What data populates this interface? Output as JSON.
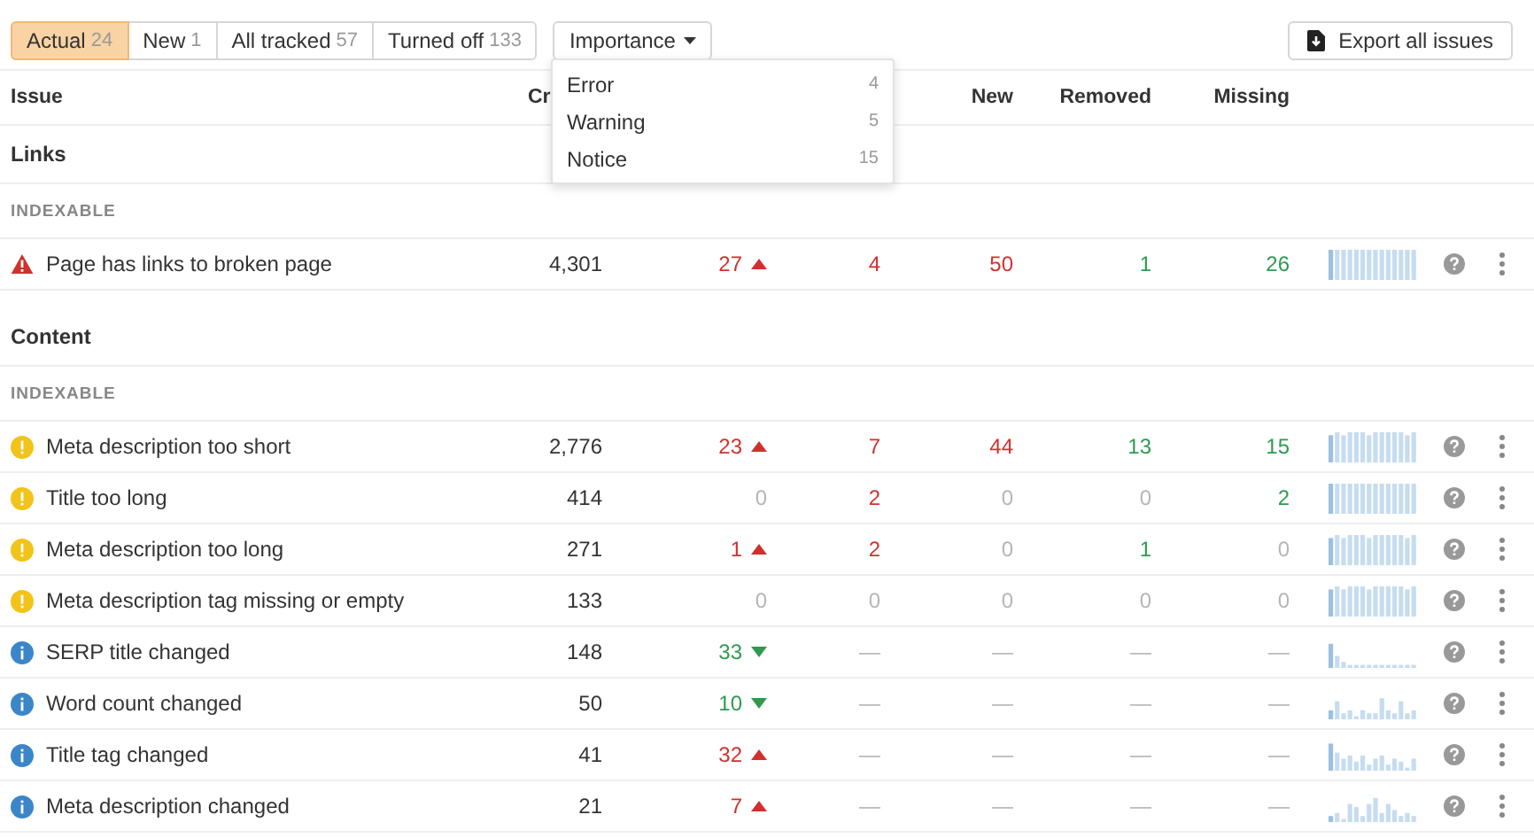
{
  "tabs": [
    {
      "label": "Actual",
      "count": "24",
      "selected": true
    },
    {
      "label": "New",
      "count": "1",
      "selected": false
    },
    {
      "label": "All tracked",
      "count": "57",
      "selected": false
    },
    {
      "label": "Turned off",
      "count": "133",
      "selected": false
    }
  ],
  "importance": {
    "label": "Importance",
    "expanded": true,
    "options": [
      {
        "label": "Error",
        "count": "4"
      },
      {
        "label": "Warning",
        "count": "5"
      },
      {
        "label": "Notice",
        "count": "15"
      }
    ]
  },
  "export_button": "Export all issues",
  "table": {
    "columns": [
      "Issue",
      "Cr",
      "New",
      "Removed",
      "Missing"
    ],
    "sections": [
      {
        "title": "Links",
        "groups": [
          {
            "label": "INDEXABLE",
            "rows": [
              {
                "kind": "error",
                "issue": "Page has links to broken page",
                "crawled": "4,301",
                "change": {
                  "text": "27",
                  "color": "#d0312d",
                  "kind": "up"
                },
                "column_4": {
                  "text": "4",
                  "color": "#d0312d"
                },
                "new": {
                  "text": "50",
                  "color": "#d0312d"
                },
                "removed": {
                  "text": "1",
                  "color": "#2e9a4e"
                },
                "missing": {
                  "text": "26",
                  "color": "#2e9a4e"
                }
              }
            ]
          }
        ]
      },
      {
        "title": "Content",
        "groups": [
          {
            "label": "INDEXABLE",
            "rows": [
              {
                "kind": "warning",
                "issue": "Meta description too short",
                "crawled": "2,776",
                "change": {
                  "text": "23",
                  "color": "#d0312d",
                  "kind": "up"
                },
                "column_4": {
                  "text": "7",
                  "color": "#d0312d"
                },
                "new": {
                  "text": "44",
                  "color": "#d0312d"
                },
                "removed": {
                  "text": "13",
                  "color": "#2e9a4e"
                },
                "missing": {
                  "text": "15",
                  "color": "#2e9a4e"
                }
              },
              {
                "kind": "warning",
                "issue": "Title too long",
                "crawled": "414",
                "change": {
                  "text": "0",
                  "color": "#b5b5b5",
                  "kind": "none"
                },
                "column_4": {
                  "text": "2",
                  "color": "#d0312d"
                },
                "new": {
                  "text": "0",
                  "color": "#b5b5b5"
                },
                "removed": {
                  "text": "0",
                  "color": "#b5b5b5"
                },
                "missing": {
                  "text": "2",
                  "color": "#2e9a4e"
                }
              },
              {
                "kind": "warning",
                "issue": "Meta description too long",
                "crawled": "271",
                "change": {
                  "text": "1",
                  "color": "#d0312d",
                  "kind": "up"
                },
                "column_4": {
                  "text": "2",
                  "color": "#d0312d"
                },
                "new": {
                  "text": "0",
                  "color": "#b5b5b5"
                },
                "removed": {
                  "text": "1",
                  "color": "#2e9a4e"
                },
                "missing": {
                  "text": "0",
                  "color": "#b5b5b5"
                }
              },
              {
                "kind": "warning",
                "issue": "Meta description tag missing or empty",
                "crawled": "133",
                "change": {
                  "text": "0",
                  "color": "#b5b5b5",
                  "kind": "none"
                },
                "column_4": {
                  "text": "0",
                  "color": "#b5b5b5"
                },
                "new": {
                  "text": "0",
                  "color": "#b5b5b5"
                },
                "removed": {
                  "text": "0",
                  "color": "#b5b5b5"
                },
                "missing": {
                  "text": "0",
                  "color": "#b5b5b5"
                }
              },
              {
                "kind": "notice",
                "issue": "SERP title changed",
                "crawled": "148",
                "change": {
                  "text": "33",
                  "color": "#2e9a4e",
                  "kind": "down"
                },
                "column_4": {
                  "text": "—",
                  "color": "#b5b5b5"
                },
                "new": {
                  "text": "—",
                  "color": "#b5b5b5"
                },
                "removed": {
                  "text": "—",
                  "color": "#b5b5b5"
                },
                "missing": {
                  "text": "—",
                  "color": "#b5b5b5"
                }
              },
              {
                "kind": "notice",
                "issue": "Word count changed",
                "crawled": "50",
                "change": {
                  "text": "10",
                  "color": "#2e9a4e",
                  "kind": "down"
                },
                "column_4": {
                  "text": "—",
                  "color": "#b5b5b5"
                },
                "new": {
                  "text": "—",
                  "color": "#b5b5b5"
                },
                "removed": {
                  "text": "—",
                  "color": "#b5b5b5"
                },
                "missing": {
                  "text": "—",
                  "color": "#b5b5b5"
                }
              },
              {
                "kind": "notice",
                "issue": "Title tag changed",
                "crawled": "41",
                "change": {
                  "text": "32",
                  "color": "#d0312d",
                  "kind": "up"
                },
                "column_4": {
                  "text": "—",
                  "color": "#b5b5b5"
                },
                "new": {
                  "text": "—",
                  "color": "#b5b5b5"
                },
                "removed": {
                  "text": "—",
                  "color": "#b5b5b5"
                },
                "missing": {
                  "text": "—",
                  "color": "#b5b5b5"
                }
              },
              {
                "kind": "notice",
                "issue": "Meta description changed",
                "crawled": "21",
                "change": {
                  "text": "7",
                  "color": "#d0312d",
                  "kind": "up"
                },
                "column_4": {
                  "text": "—",
                  "color": "#b5b5b5"
                },
                "new": {
                  "text": "—",
                  "color": "#b5b5b5"
                },
                "removed": {
                  "text": "—",
                  "color": "#b5b5b5"
                },
                "missing": {
                  "text": "—",
                  "color": "#b5b5b5"
                }
              }
            ]
          }
        ]
      }
    ]
  }
}
